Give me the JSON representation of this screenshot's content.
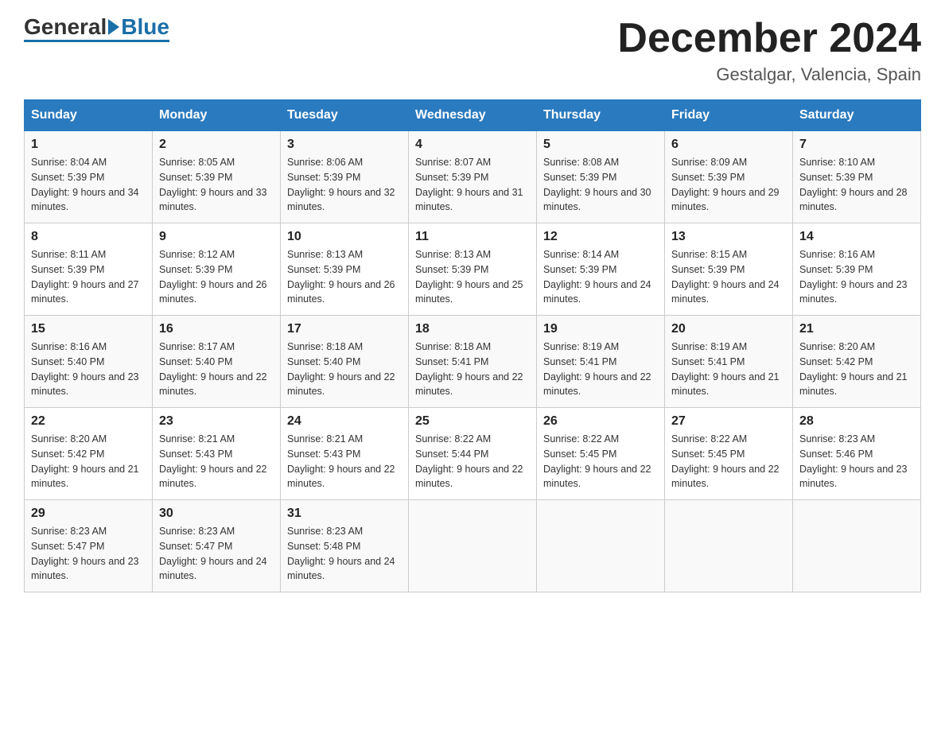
{
  "logo": {
    "general": "General",
    "blue": "Blue"
  },
  "header": {
    "month_year": "December 2024",
    "location": "Gestalgar, Valencia, Spain"
  },
  "weekdays": [
    "Sunday",
    "Monday",
    "Tuesday",
    "Wednesday",
    "Thursday",
    "Friday",
    "Saturday"
  ],
  "weeks": [
    [
      {
        "day": "1",
        "sunrise": "8:04 AM",
        "sunset": "5:39 PM",
        "daylight": "9 hours and 34 minutes."
      },
      {
        "day": "2",
        "sunrise": "8:05 AM",
        "sunset": "5:39 PM",
        "daylight": "9 hours and 33 minutes."
      },
      {
        "day": "3",
        "sunrise": "8:06 AM",
        "sunset": "5:39 PM",
        "daylight": "9 hours and 32 minutes."
      },
      {
        "day": "4",
        "sunrise": "8:07 AM",
        "sunset": "5:39 PM",
        "daylight": "9 hours and 31 minutes."
      },
      {
        "day": "5",
        "sunrise": "8:08 AM",
        "sunset": "5:39 PM",
        "daylight": "9 hours and 30 minutes."
      },
      {
        "day": "6",
        "sunrise": "8:09 AM",
        "sunset": "5:39 PM",
        "daylight": "9 hours and 29 minutes."
      },
      {
        "day": "7",
        "sunrise": "8:10 AM",
        "sunset": "5:39 PM",
        "daylight": "9 hours and 28 minutes."
      }
    ],
    [
      {
        "day": "8",
        "sunrise": "8:11 AM",
        "sunset": "5:39 PM",
        "daylight": "9 hours and 27 minutes."
      },
      {
        "day": "9",
        "sunrise": "8:12 AM",
        "sunset": "5:39 PM",
        "daylight": "9 hours and 26 minutes."
      },
      {
        "day": "10",
        "sunrise": "8:13 AM",
        "sunset": "5:39 PM",
        "daylight": "9 hours and 26 minutes."
      },
      {
        "day": "11",
        "sunrise": "8:13 AM",
        "sunset": "5:39 PM",
        "daylight": "9 hours and 25 minutes."
      },
      {
        "day": "12",
        "sunrise": "8:14 AM",
        "sunset": "5:39 PM",
        "daylight": "9 hours and 24 minutes."
      },
      {
        "day": "13",
        "sunrise": "8:15 AM",
        "sunset": "5:39 PM",
        "daylight": "9 hours and 24 minutes."
      },
      {
        "day": "14",
        "sunrise": "8:16 AM",
        "sunset": "5:39 PM",
        "daylight": "9 hours and 23 minutes."
      }
    ],
    [
      {
        "day": "15",
        "sunrise": "8:16 AM",
        "sunset": "5:40 PM",
        "daylight": "9 hours and 23 minutes."
      },
      {
        "day": "16",
        "sunrise": "8:17 AM",
        "sunset": "5:40 PM",
        "daylight": "9 hours and 22 minutes."
      },
      {
        "day": "17",
        "sunrise": "8:18 AM",
        "sunset": "5:40 PM",
        "daylight": "9 hours and 22 minutes."
      },
      {
        "day": "18",
        "sunrise": "8:18 AM",
        "sunset": "5:41 PM",
        "daylight": "9 hours and 22 minutes."
      },
      {
        "day": "19",
        "sunrise": "8:19 AM",
        "sunset": "5:41 PM",
        "daylight": "9 hours and 22 minutes."
      },
      {
        "day": "20",
        "sunrise": "8:19 AM",
        "sunset": "5:41 PM",
        "daylight": "9 hours and 21 minutes."
      },
      {
        "day": "21",
        "sunrise": "8:20 AM",
        "sunset": "5:42 PM",
        "daylight": "9 hours and 21 minutes."
      }
    ],
    [
      {
        "day": "22",
        "sunrise": "8:20 AM",
        "sunset": "5:42 PM",
        "daylight": "9 hours and 21 minutes."
      },
      {
        "day": "23",
        "sunrise": "8:21 AM",
        "sunset": "5:43 PM",
        "daylight": "9 hours and 22 minutes."
      },
      {
        "day": "24",
        "sunrise": "8:21 AM",
        "sunset": "5:43 PM",
        "daylight": "9 hours and 22 minutes."
      },
      {
        "day": "25",
        "sunrise": "8:22 AM",
        "sunset": "5:44 PM",
        "daylight": "9 hours and 22 minutes."
      },
      {
        "day": "26",
        "sunrise": "8:22 AM",
        "sunset": "5:45 PM",
        "daylight": "9 hours and 22 minutes."
      },
      {
        "day": "27",
        "sunrise": "8:22 AM",
        "sunset": "5:45 PM",
        "daylight": "9 hours and 22 minutes."
      },
      {
        "day": "28",
        "sunrise": "8:23 AM",
        "sunset": "5:46 PM",
        "daylight": "9 hours and 23 minutes."
      }
    ],
    [
      {
        "day": "29",
        "sunrise": "8:23 AM",
        "sunset": "5:47 PM",
        "daylight": "9 hours and 23 minutes."
      },
      {
        "day": "30",
        "sunrise": "8:23 AM",
        "sunset": "5:47 PM",
        "daylight": "9 hours and 24 minutes."
      },
      {
        "day": "31",
        "sunrise": "8:23 AM",
        "sunset": "5:48 PM",
        "daylight": "9 hours and 24 minutes."
      },
      null,
      null,
      null,
      null
    ]
  ],
  "labels": {
    "sunrise": "Sunrise:",
    "sunset": "Sunset:",
    "daylight": "Daylight:"
  }
}
